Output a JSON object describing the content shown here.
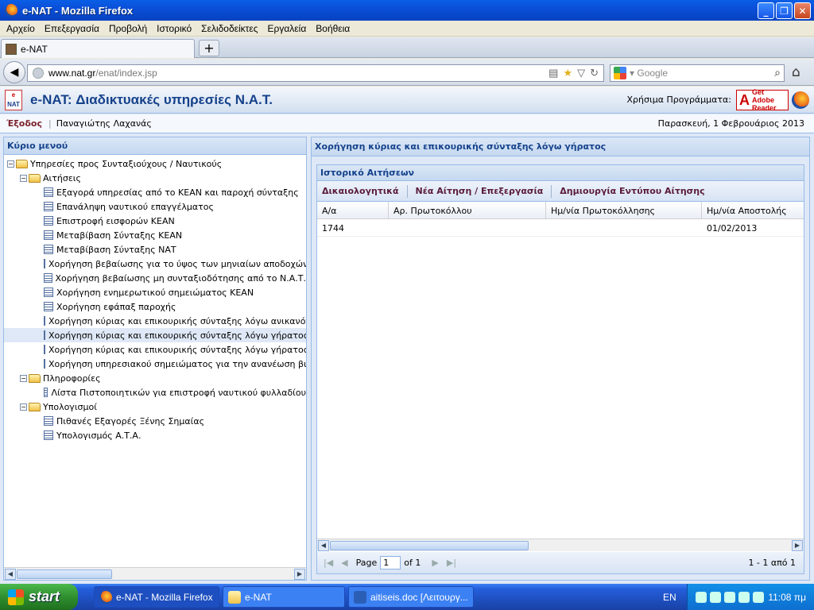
{
  "window": {
    "title": "e-NAT - Mozilla Firefox"
  },
  "menu": [
    "Αρχείο",
    "Επεξεργασία",
    "Προβολή",
    "Ιστορικό",
    "Σελιδοδείκτες",
    "Εργαλεία",
    "Βοήθεια"
  ],
  "tab": {
    "label": "e-NAT"
  },
  "nav": {
    "url_host": "www.nat.gr",
    "url_path": "/enat/index.jsp",
    "search_placeholder": "Google"
  },
  "app": {
    "logo_top": "e",
    "logo_bottom": "NAT",
    "title": "e-NAT: Διαδικτυακές υπηρεσίες Ν.Α.Τ.",
    "useful_label": "Χρήσιμα Προγράμματα:",
    "adobe_a": "A",
    "adobe_get": "Get",
    "adobe_brand": "Adobe",
    "adobe_reader": "Reader",
    "logout": "Έξοδος",
    "user": "Παναγιώτης Λαχανάς",
    "date": "Παρασκευή, 1 Φεβρουάριος 2013"
  },
  "left": {
    "title": "Κύριο μενού",
    "tree": [
      {
        "label": "Υπηρεσίες προς Συνταξιούχους / Ναυτικούς",
        "level": 0,
        "kind": "folder"
      },
      {
        "label": "Αιτήσεις",
        "level": 1,
        "kind": "folder"
      },
      {
        "label": "Εξαγορά υπηρεσίας από το ΚΕΑΝ και παροχή σύνταξης",
        "level": 2,
        "kind": "leaf"
      },
      {
        "label": "Επανάληψη ναυτικού επαγγέλματος",
        "level": 2,
        "kind": "leaf"
      },
      {
        "label": "Επιστροφή εισφορών ΚΕΑΝ",
        "level": 2,
        "kind": "leaf"
      },
      {
        "label": "Μεταβίβαση Σύνταξης ΚΕΑΝ",
        "level": 2,
        "kind": "leaf"
      },
      {
        "label": "Μεταβίβαση Σύνταξης ΝΑΤ",
        "level": 2,
        "kind": "leaf"
      },
      {
        "label": "Χορήγηση βεβαίωσης για το ύψος των μηνιαίων αποδοχών κύρια",
        "level": 2,
        "kind": "leaf"
      },
      {
        "label": "Χορήγηση βεβαίωσης μη συνταξιοδότησης από το Ν.Α.Τ.",
        "level": 2,
        "kind": "leaf"
      },
      {
        "label": "Χορήγηση ενημερωτικού σημειώματος ΚΕΑΝ",
        "level": 2,
        "kind": "leaf"
      },
      {
        "label": "Χορήγηση εφάπαξ παροχής",
        "level": 2,
        "kind": "leaf"
      },
      {
        "label": "Χορήγηση κύριας και επικουρικής σύνταξης λόγω ανικανότητας -",
        "level": 2,
        "kind": "leaf"
      },
      {
        "label": "Χορήγηση κύριας και επικουρικής σύνταξης λόγω γήρατος",
        "level": 2,
        "kind": "leaf",
        "selected": true
      },
      {
        "label": "Χορήγηση κύριας και επικουρικής σύνταξης λόγω γήρατος με δια",
        "level": 2,
        "kind": "leaf"
      },
      {
        "label": "Χορήγηση υπηρεσιακού σημειώματος για την ανανέωση βιβλιαρίο",
        "level": 2,
        "kind": "leaf"
      },
      {
        "label": "Πληροφορίες",
        "level": 1,
        "kind": "folder"
      },
      {
        "label": "Λίστα Πιστοποιητικών για επιστροφή ναυτικού φυλλαδίου",
        "level": 2,
        "kind": "leaf"
      },
      {
        "label": "Υπολογισμοί",
        "level": 1,
        "kind": "folder"
      },
      {
        "label": "Πιθανές Εξαγορές Ξένης Σημαίας",
        "level": 2,
        "kind": "leaf"
      },
      {
        "label": "Υπολογισμός Α.Τ.Α.",
        "level": 2,
        "kind": "leaf"
      }
    ]
  },
  "right": {
    "title": "Χορήγηση κύριας και επικουρικής σύνταξης λόγω γήρατος",
    "grid_title": "Ιστορικό Αιτήσεων",
    "toolbar": [
      "Δικαιολογητικά",
      "Νέα Αίτηση / Επεξεργασία",
      "Δημιουργία Εντύπου Αίτησης"
    ],
    "columns": [
      "Α/α",
      "Αρ. Πρωτοκόλλου",
      "Ημ/νία Πρωτοκόλλησης",
      "Ημ/νία Αποστολής"
    ],
    "rows": [
      [
        "1744",
        "",
        "",
        "01/02/2013"
      ]
    ],
    "paging": {
      "page_label": "Page",
      "page_value": "1",
      "of_label": "of 1",
      "display": "1 - 1 από 1"
    }
  },
  "taskbar": {
    "start": "start",
    "items": [
      "e-NAT - Mozilla Firefox",
      "e-NAT",
      "aitiseis.doc [Λειτουργ..."
    ],
    "lang": "EN",
    "clock": "11:08 πμ"
  }
}
